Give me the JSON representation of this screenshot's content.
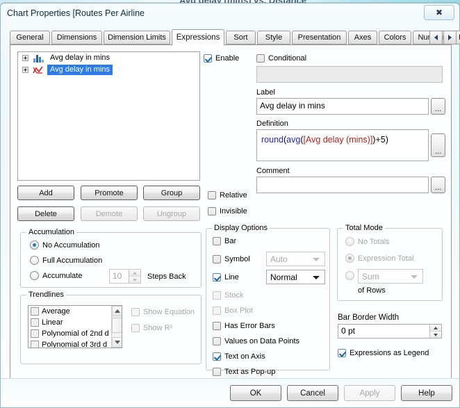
{
  "backdrop": {
    "ghost_text": "Avg delay (mins) vs. Distance"
  },
  "window": {
    "title": "Chart Properties [Routes Per Airline",
    "close_label": "✖"
  },
  "tabs": [
    {
      "label": "General",
      "active": false
    },
    {
      "label": "Dimensions",
      "active": false
    },
    {
      "label": "Dimension Limits",
      "active": false
    },
    {
      "label": "Expressions",
      "active": true
    },
    {
      "label": "Sort",
      "active": false
    },
    {
      "label": "Style",
      "active": false
    },
    {
      "label": "Presentation",
      "active": false
    },
    {
      "label": "Axes",
      "active": false
    },
    {
      "label": "Colors",
      "active": false
    },
    {
      "label": "Number",
      "active": false
    },
    {
      "label": "Font",
      "active": false
    }
  ],
  "expressions": [
    {
      "label": "Avg delay in mins",
      "icon": "bar-chart-icon",
      "selected": false
    },
    {
      "label": "Avg delay in mins",
      "icon": "line-chart-icon",
      "selected": true
    }
  ],
  "list_buttons": {
    "add": "Add",
    "promote": "Promote",
    "group": "Group",
    "delete": "Delete",
    "demote": "Demote",
    "ungroup": "Ungroup"
  },
  "accumulation": {
    "legend": "Accumulation",
    "no_accumulation": "No Accumulation",
    "full_accumulation": "Full Accumulation",
    "accumulate": "Accumulate",
    "steps_value": "10",
    "steps_label": "Steps Back"
  },
  "trendlines": {
    "legend": "Trendlines",
    "items": [
      "Average",
      "Linear",
      "Polynomial of 2nd d",
      "Polynomial of 3rd d"
    ],
    "show_equation": "Show Equation",
    "show_r2": "Show R²"
  },
  "right_panel": {
    "enable": "Enable",
    "conditional": "Conditional",
    "conditional_value": "",
    "label_caption": "Label",
    "label_value": "Avg delay in mins",
    "definition_caption": "Definition",
    "definition_tokens": [
      {
        "text": "round",
        "type": "fn"
      },
      {
        "text": "(",
        "type": "plain"
      },
      {
        "text": "avg",
        "type": "fn"
      },
      {
        "text": "(",
        "type": "plain"
      },
      {
        "text": "[Avg delay (mins)]",
        "type": "field"
      },
      {
        "text": ")+5)",
        "type": "plain"
      }
    ],
    "definition_plain": "round(avg([Avg delay (mins)])+5)",
    "comment_caption": "Comment",
    "comment_value": "",
    "ellipsis": "...",
    "relative": "Relative",
    "invisible": "Invisible"
  },
  "display_options": {
    "legend": "Display Options",
    "bar": "Bar",
    "symbol": "Symbol",
    "symbol_combo": "Auto",
    "line": "Line",
    "line_combo": "Normal",
    "stock": "Stock",
    "box_plot": "Box Plot",
    "has_error_bars": "Has Error Bars",
    "values_on_data_points": "Values on Data Points",
    "text_on_axis": "Text on Axis",
    "text_as_popup": "Text as Pop-up"
  },
  "total_mode": {
    "legend": "Total Mode",
    "no_totals": "No Totals",
    "expression_total": "Expression Total",
    "aggregation": "Sum",
    "of_rows": "of Rows"
  },
  "bar_border": {
    "caption": "Bar Border Width",
    "value": "0 pt",
    "expressions_as_legend": "Expressions as Legend"
  },
  "footer": {
    "ok": "OK",
    "cancel": "Cancel",
    "apply": "Apply",
    "help": "Help"
  },
  "colors": {
    "selection_blue": "#2c7bea",
    "function_token": "#2222cc",
    "field_token": "#b02020",
    "accent_checkbox": "#1c64b0"
  }
}
